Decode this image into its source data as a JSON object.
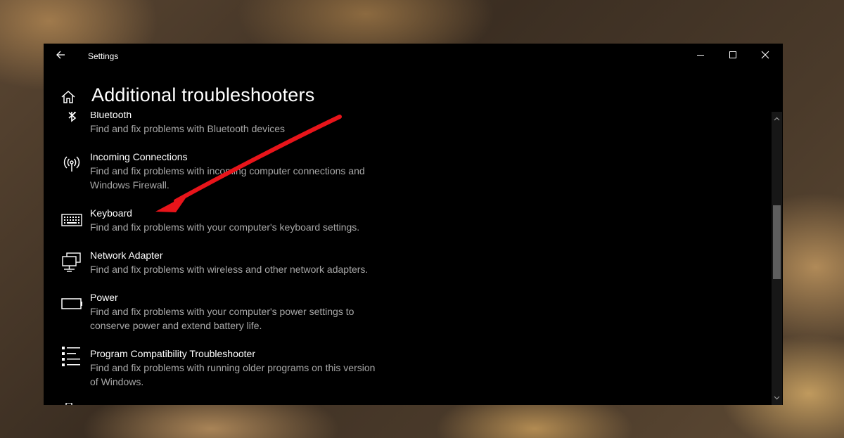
{
  "window": {
    "app_title": "Settings",
    "back_icon": "back-arrow-icon",
    "controls": [
      "minimize-icon",
      "maximize-icon",
      "close-icon"
    ]
  },
  "page": {
    "title": "Additional troubleshooters",
    "home_icon": "home-icon"
  },
  "troubleshooters": [
    {
      "name": "Bluetooth",
      "description": "Find and fix problems with Bluetooth devices",
      "icon": "bluetooth-icon"
    },
    {
      "name": "Incoming Connections",
      "description": "Find and fix problems with incoming computer connections and Windows Firewall.",
      "icon": "wireless-antenna-icon"
    },
    {
      "name": "Keyboard",
      "description": "Find and fix problems with your computer's keyboard settings.",
      "icon": "keyboard-icon"
    },
    {
      "name": "Network Adapter",
      "description": "Find and fix problems with wireless and other network adapters.",
      "icon": "network-adapter-icon"
    },
    {
      "name": "Power",
      "description": "Find and fix problems with your computer's power settings to conserve power and extend battery life.",
      "icon": "battery-icon"
    },
    {
      "name": "Program Compatibility Troubleshooter",
      "description": "Find and fix problems with running older programs on this version of Windows.",
      "icon": "list-icon"
    }
  ],
  "annotation": {
    "type": "arrow",
    "color": "#e8141a",
    "points_to": "Keyboard"
  },
  "colors": {
    "window_bg": "#000000",
    "title_text": "#ffffff",
    "description_text": "#a8a8a8",
    "scrollbar_thumb": "#5e5e5e"
  }
}
